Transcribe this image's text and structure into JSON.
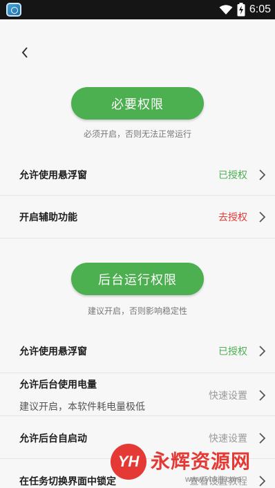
{
  "statusbar": {
    "time": "6:05"
  },
  "nav": {
    "back_icon": "chevron-left-icon"
  },
  "required": {
    "button_label": "必要权限",
    "caption": "必须开启，否则无法正常运行",
    "rows": [
      {
        "title": "允许使用悬浮窗",
        "status": "已授权"
      },
      {
        "title": "开启辅助功能",
        "status": "去授权"
      }
    ]
  },
  "background": {
    "button_label": "后台运行权限",
    "caption": "建议开启，否则影响稳定性",
    "rows": [
      {
        "title": "允许使用悬浮窗",
        "status": "已授权"
      },
      {
        "title": "允许后台使用电量",
        "subtitle": "建议开启，本软件耗电量极低",
        "status": "快速设置"
      },
      {
        "title": "允许后台自启动",
        "status": "快速设置"
      },
      {
        "title": "在任务切换界面中锁定",
        "status": "查看设置教程"
      }
    ]
  },
  "watermark": {
    "logo": "YH",
    "name": "永辉资源网",
    "url": "www.yhkjjj.com"
  },
  "colors": {
    "accent": "#4caf50",
    "danger": "#e53935",
    "muted": "#9a9a9a"
  }
}
